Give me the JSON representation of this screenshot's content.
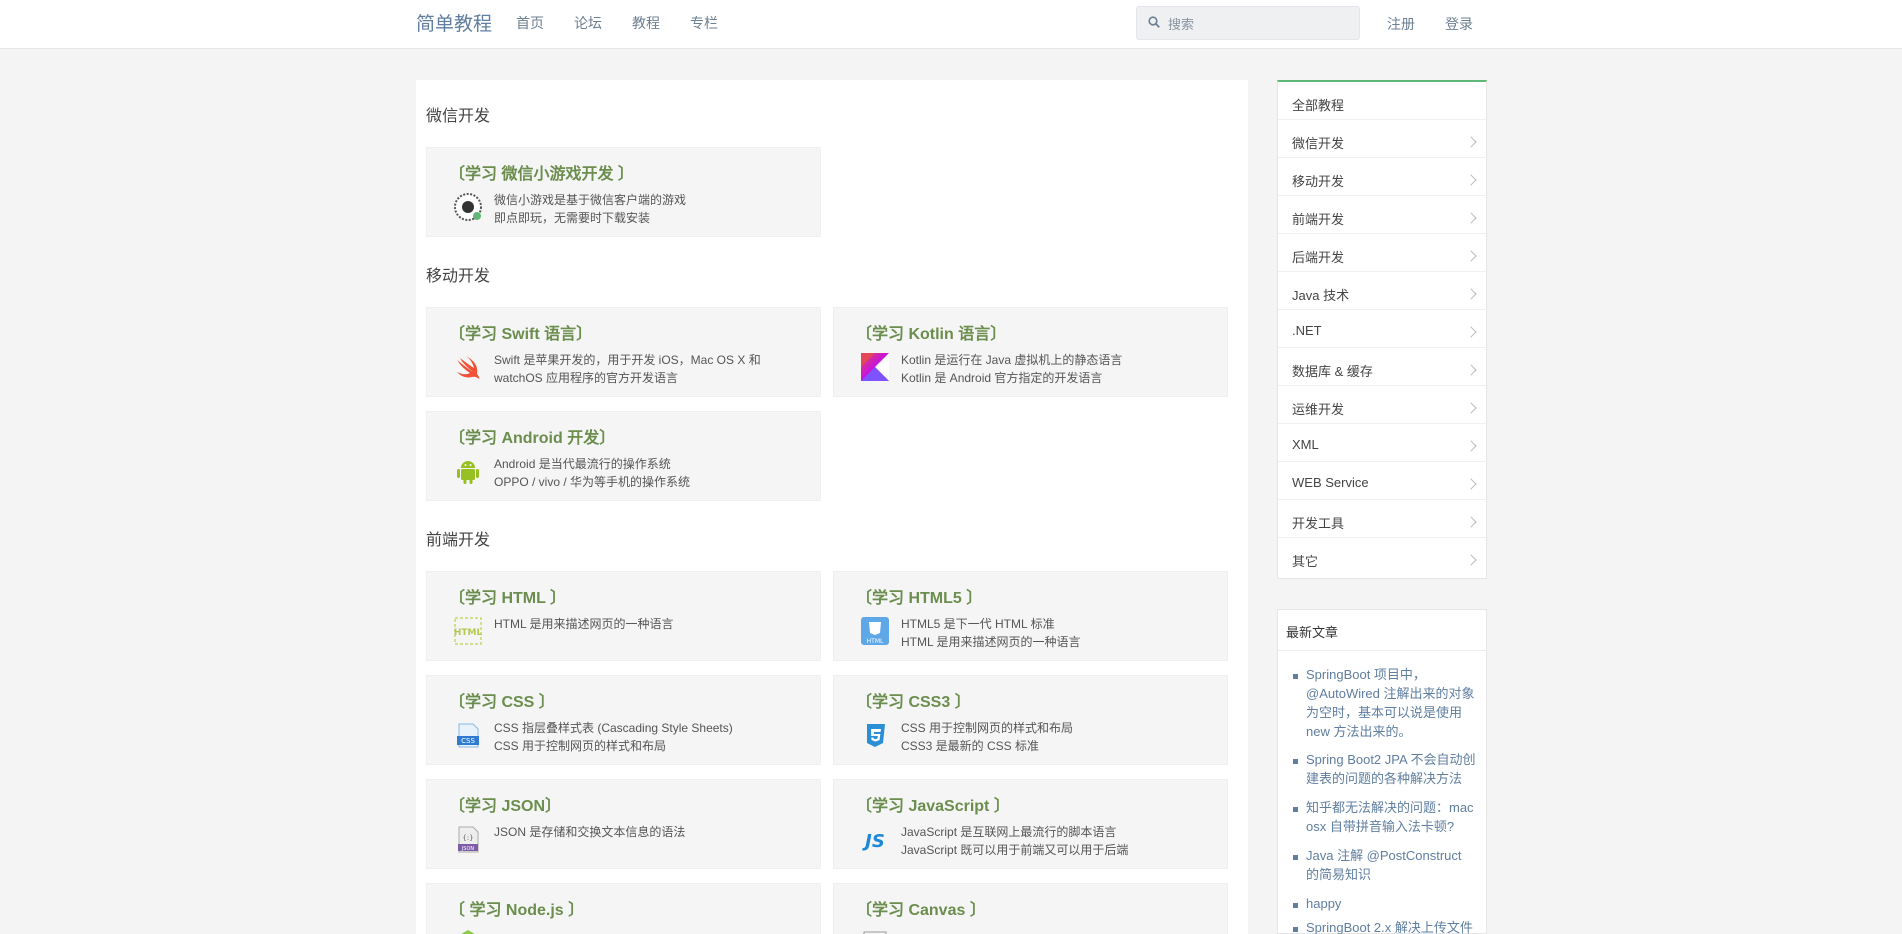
{
  "header": {
    "brand": "简单教程",
    "nav": [
      "首页",
      "论坛",
      "教程",
      "专栏"
    ],
    "search_placeholder": "搜索",
    "register": "注册",
    "login": "登录"
  },
  "sections": [
    {
      "title": "微信开发",
      "cards": [
        {
          "title": "〔学习 微信小游戏开发 〕",
          "icon": "wechat-qrcode-icon",
          "line1": "微信小游戏是基于微信客户端的游戏",
          "line2": "即点即玩，无需要时下载安装"
        }
      ]
    },
    {
      "title": "移动开发",
      "cards": [
        {
          "title": "〔学习 Swift 语言〕",
          "icon": "swift-icon",
          "line1": "Swift 是苹果开发的，用于开发 iOS，Mac OS X 和",
          "line2": "watchOS 应用程序的官方开发语言"
        },
        {
          "title": "〔学习 Kotlin 语言〕",
          "icon": "kotlin-icon",
          "line1": "Kotlin 是运行在 Java 虚拟机上的静态语言",
          "line2": "Kotlin 是 Android 官方指定的开发语言"
        },
        {
          "title": "〔学习 Android 开发〕",
          "icon": "android-icon",
          "line1": "Android 是当代最流行的操作系统",
          "line2": "OPPO / vivo / 华为等手机的操作系统"
        }
      ]
    },
    {
      "title": "前端开发",
      "cards": [
        {
          "title": "〔学习 HTML 〕",
          "icon": "html-icon",
          "line1": "HTML 是用来描述网页的一种语言",
          "line2": ""
        },
        {
          "title": "〔学习 HTML5 〕",
          "icon": "html5-icon",
          "line1": "HTML5 是下一代 HTML 标准",
          "line2": "HTML 是用来描述网页的一种语言"
        },
        {
          "title": "〔学习 CSS 〕",
          "icon": "css-icon",
          "line1": "CSS 指层叠样式表 (Cascading Style Sheets)",
          "line2": "CSS 用于控制网页的样式和布局"
        },
        {
          "title": "〔学习 CSS3 〕",
          "icon": "css3-icon",
          "line1": "CSS 用于控制网页的样式和布局",
          "line2": "CSS3 是最新的 CSS 标准"
        },
        {
          "title": "〔学习 JSON〕",
          "icon": "json-icon",
          "line1": "JSON 是存储和交换文本信息的语法",
          "line2": ""
        },
        {
          "title": "〔学习 JavaScript 〕",
          "icon": "javascript-icon",
          "line1": "JavaScript 是互联网上最流行的脚本语言",
          "line2": "JavaScript 既可以用于前端又可以用于后端"
        },
        {
          "title": "〔 学习 Node.js 〕",
          "icon": "nodejs-icon",
          "line1": "",
          "line2": ""
        },
        {
          "title": "〔学习 Canvas 〕",
          "icon": "canvas-icon",
          "line1": "",
          "line2": ""
        }
      ]
    }
  ],
  "sidebar": {
    "items": [
      "全部教程",
      "微信开发",
      "移动开发",
      "前端开发",
      "后端开发",
      "Java 技术",
      ".NET",
      "数据库 & 缓存",
      "运维开发",
      "XML",
      "WEB Service",
      "开发工具",
      "其它"
    ]
  },
  "latest": {
    "title": "最新文章",
    "items": [
      "SpringBoot 项目中，@AutoWired 注解出来的对象为空时，基本可以说是使用 new 方法出来的。",
      "Spring Boot2 JPA 不会自动创建表的问题的各种解决方法",
      "知乎都无法解决的问题：mac osx 自带拼音输入法卡顿?",
      "Java 注解 @PostConstruct 的简易知识",
      "happy",
      "SpringBoot 2.x 解决上传文件"
    ]
  },
  "colors": {
    "accent_green": "#5fb878",
    "title_green": "#6b8e4e",
    "link_blue": "#5f7ea0"
  }
}
